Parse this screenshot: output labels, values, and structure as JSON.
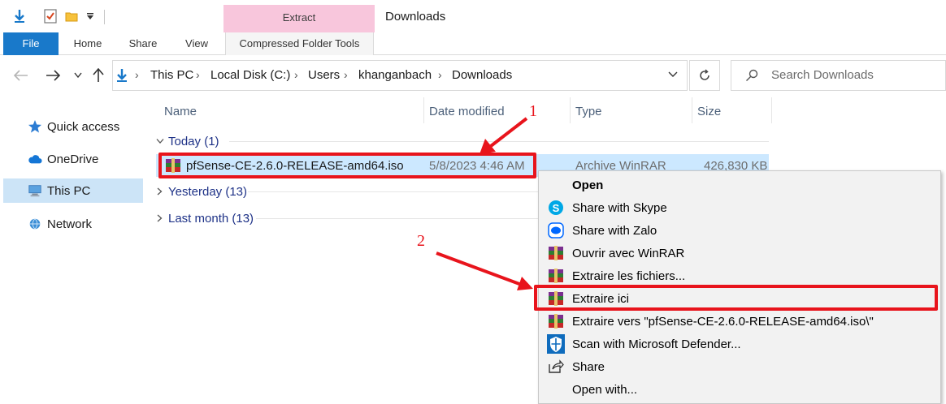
{
  "window": {
    "title": "Downloads"
  },
  "ribbon": {
    "context_group": "Extract",
    "tabs": [
      {
        "label": "File"
      },
      {
        "label": "Home"
      },
      {
        "label": "Share"
      },
      {
        "label": "View"
      },
      {
        "label": "Compressed Folder Tools"
      }
    ]
  },
  "breadcrumb": [
    "This PC",
    "Local Disk (C:)",
    "Users",
    "khanganbach",
    "Downloads"
  ],
  "search": {
    "placeholder": "Search Downloads"
  },
  "sidebar": {
    "items": [
      {
        "label": "Quick access",
        "icon": "star-icon"
      },
      {
        "label": "OneDrive",
        "icon": "cloud-icon"
      },
      {
        "label": "This PC",
        "icon": "computer-icon",
        "selected": true
      },
      {
        "label": "Network",
        "icon": "network-icon"
      }
    ]
  },
  "columns": [
    "Name",
    "Date modified",
    "Type",
    "Size"
  ],
  "groups": [
    {
      "label": "Today (1)",
      "expanded": true
    },
    {
      "label": "Yesterday (13)",
      "expanded": false
    },
    {
      "label": "Last month (13)",
      "expanded": false
    }
  ],
  "file": {
    "name": "pfSense-CE-2.6.0-RELEASE-amd64.iso",
    "date": "5/8/2023 4:46 AM",
    "type": "Archive WinRAR",
    "size": "426,830 KB"
  },
  "context_menu": {
    "items": [
      {
        "label": "Open",
        "icon": "none"
      },
      {
        "label": "Share with Skype",
        "icon": "skype-icon"
      },
      {
        "label": "Share with Zalo",
        "icon": "zalo-icon"
      },
      {
        "label": "Ouvrir avec WinRAR",
        "icon": "winrar-icon"
      },
      {
        "label": "Extraire les fichiers...",
        "icon": "winrar-icon"
      },
      {
        "label": "Extraire ici",
        "icon": "winrar-icon"
      },
      {
        "label": "Extraire vers \"pfSense-CE-2.6.0-RELEASE-amd64.iso\\\"",
        "icon": "winrar-icon"
      },
      {
        "label": "Scan with Microsoft Defender...",
        "icon": "defender-icon"
      },
      {
        "label": "Share",
        "icon": "share-icon"
      },
      {
        "label": "Open with...",
        "icon": "none"
      }
    ]
  },
  "annotations": [
    {
      "number": "1",
      "color": "#e8141c"
    },
    {
      "number": "2",
      "color": "#e8141c"
    }
  ],
  "colors": {
    "accent": "#1979ca",
    "selection": "#cce8ff",
    "tool_context": "#f8c6dc",
    "annotation": "#e8141c"
  }
}
